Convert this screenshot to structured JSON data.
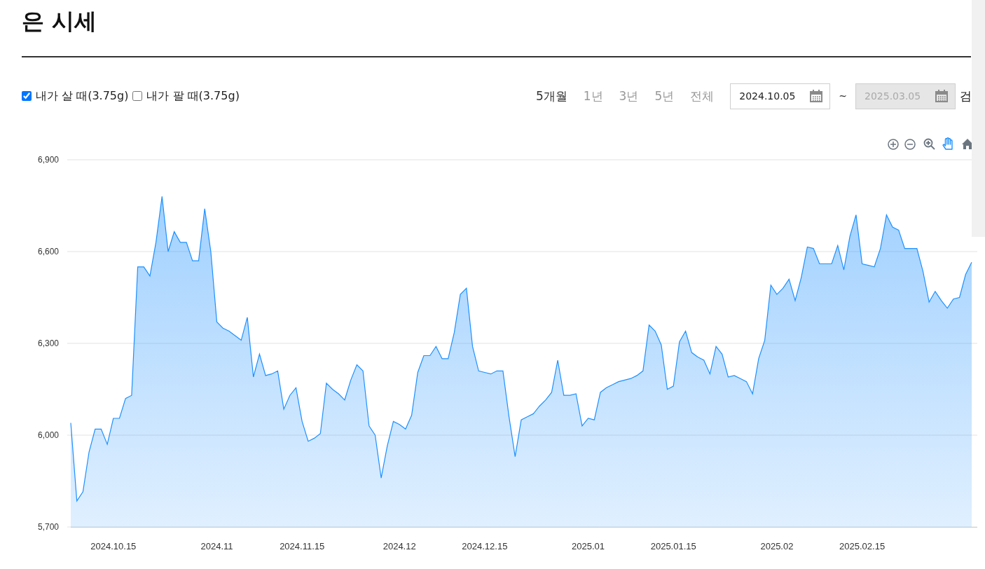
{
  "title": "은 시세",
  "options": [
    {
      "label": "내가 살 때(3.75g)",
      "checked": true
    },
    {
      "label": "내가 팔 때(3.75g)",
      "checked": false
    }
  ],
  "periods": [
    {
      "label": "5개월",
      "selected": true
    },
    {
      "label": "1년",
      "selected": false
    },
    {
      "label": "3년",
      "selected": false
    },
    {
      "label": "5년",
      "selected": false
    },
    {
      "label": "전체",
      "selected": false
    }
  ],
  "date_range": [
    {
      "value": "2024.10.05",
      "disabled": false
    },
    {
      "value": "2025.03.05",
      "disabled": true
    }
  ],
  "date_separator": "~",
  "search_button": "검",
  "toolbar": [
    {
      "kind": "zoom-in",
      "selected": false
    },
    {
      "kind": "zoom-out",
      "selected": false
    },
    {
      "kind": "magnify",
      "selected": false
    },
    {
      "kind": "pan",
      "selected": true
    },
    {
      "kind": "home",
      "selected": false
    }
  ],
  "chart_data": {
    "type": "area",
    "grid": true,
    "ylim": [
      5700,
      6900
    ],
    "yticks": [
      {
        "value": 5700,
        "label": "5,700"
      },
      {
        "value": 6000,
        "label": "6,000"
      },
      {
        "value": 6300,
        "label": "6,300"
      },
      {
        "value": 6600,
        "label": "6,600"
      },
      {
        "value": 6900,
        "label": "6,900"
      }
    ],
    "categories": [
      null,
      null,
      null,
      null,
      null,
      null,
      null,
      "2024.10.15",
      null,
      null,
      null,
      null,
      null,
      null,
      null,
      null,
      null,
      null,
      null,
      null,
      null,
      null,
      null,
      null,
      "2024.11",
      null,
      null,
      null,
      null,
      null,
      null,
      null,
      null,
      null,
      null,
      null,
      null,
      null,
      "2024.11.15",
      null,
      null,
      null,
      null,
      null,
      null,
      null,
      null,
      null,
      null,
      null,
      null,
      null,
      null,
      null,
      "2024.12",
      null,
      null,
      null,
      null,
      null,
      null,
      null,
      null,
      null,
      null,
      null,
      null,
      null,
      "2024.12.15",
      null,
      null,
      null,
      null,
      null,
      null,
      null,
      null,
      null,
      null,
      null,
      null,
      null,
      null,
      null,
      null,
      "2025.01",
      null,
      null,
      null,
      null,
      null,
      null,
      null,
      null,
      null,
      null,
      null,
      null,
      null,
      "2025.01.15",
      null,
      null,
      null,
      null,
      null,
      null,
      null,
      null,
      null,
      null,
      null,
      null,
      null,
      null,
      null,
      null,
      "2025.02",
      null,
      null,
      null,
      null,
      null,
      null,
      null,
      null,
      null,
      null,
      null,
      null,
      null,
      "2025.02.15",
      null,
      null,
      null,
      null,
      null,
      null,
      null,
      null,
      null,
      null,
      null,
      null,
      null,
      null,
      null,
      null,
      null,
      null
    ],
    "series": [
      {
        "color": "#1e90ff",
        "values": [
          6040,
          5785,
          5815,
          5945,
          6020,
          6020,
          5970,
          6055,
          6055,
          6120,
          6130,
          6550,
          6550,
          6520,
          6630,
          6780,
          6600,
          6665,
          6630,
          6630,
          6570,
          6570,
          6740,
          6600,
          6370,
          6350,
          6340,
          6325,
          6310,
          6385,
          6190,
          6265,
          6195,
          6200,
          6210,
          6085,
          6130,
          6155,
          6045,
          5980,
          5990,
          6005,
          6170,
          6150,
          6135,
          6115,
          6180,
          6230,
          6210,
          6030,
          6000,
          5860,
          5965,
          6045,
          6035,
          6020,
          6065,
          6205,
          6260,
          6260,
          6290,
          6250,
          6250,
          6335,
          6460,
          6480,
          6290,
          6210,
          6205,
          6200,
          6210,
          6210,
          6060,
          5930,
          6050,
          6060,
          6070,
          6095,
          6115,
          6140,
          6245,
          6130,
          6130,
          6135,
          6030,
          6055,
          6050,
          6140,
          6155,
          6165,
          6175,
          6180,
          6185,
          6195,
          6210,
          6360,
          6340,
          6295,
          6150,
          6160,
          6305,
          6340,
          6270,
          6255,
          6245,
          6200,
          6290,
          6265,
          6190,
          6195,
          6185,
          6175,
          6135,
          6250,
          6310,
          6490,
          6460,
          6480,
          6510,
          6440,
          6515,
          6615,
          6610,
          6560,
          6560,
          6560,
          6620,
          6540,
          6650,
          6720,
          6560,
          6555,
          6550,
          6610,
          6720,
          6680,
          6670,
          6610,
          6610,
          6610,
          6535,
          6435,
          6470,
          6440,
          6415,
          6445,
          6450,
          6525,
          6565
        ]
      }
    ]
  }
}
